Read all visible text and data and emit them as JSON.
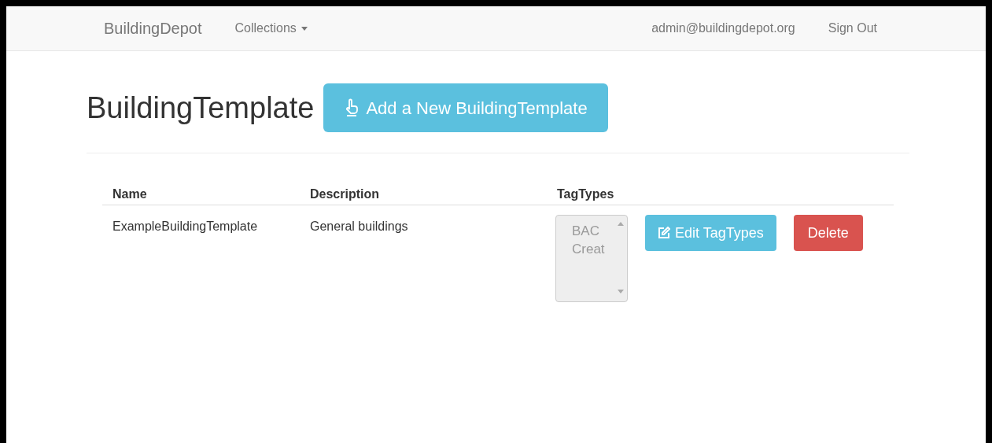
{
  "navbar": {
    "brand": "BuildingDepot",
    "menu": {
      "label": "Collections",
      "expanded": false
    },
    "user": "admin@buildingdepot.org",
    "sign_out": "Sign Out"
  },
  "page": {
    "title": "BuildingTemplate",
    "add_button": "Add a New BuildingTemplate"
  },
  "table": {
    "columns": [
      "Name",
      "Description",
      "TagTypes"
    ],
    "rows": [
      {
        "name": "ExampleBuildingTemplate",
        "description": "General buildings",
        "tag_types": {
          "disabled": true,
          "options": [
            "BAC",
            "Creat"
          ]
        },
        "edit_button": "Edit TagTypes",
        "delete_button": "Delete"
      }
    ]
  }
}
